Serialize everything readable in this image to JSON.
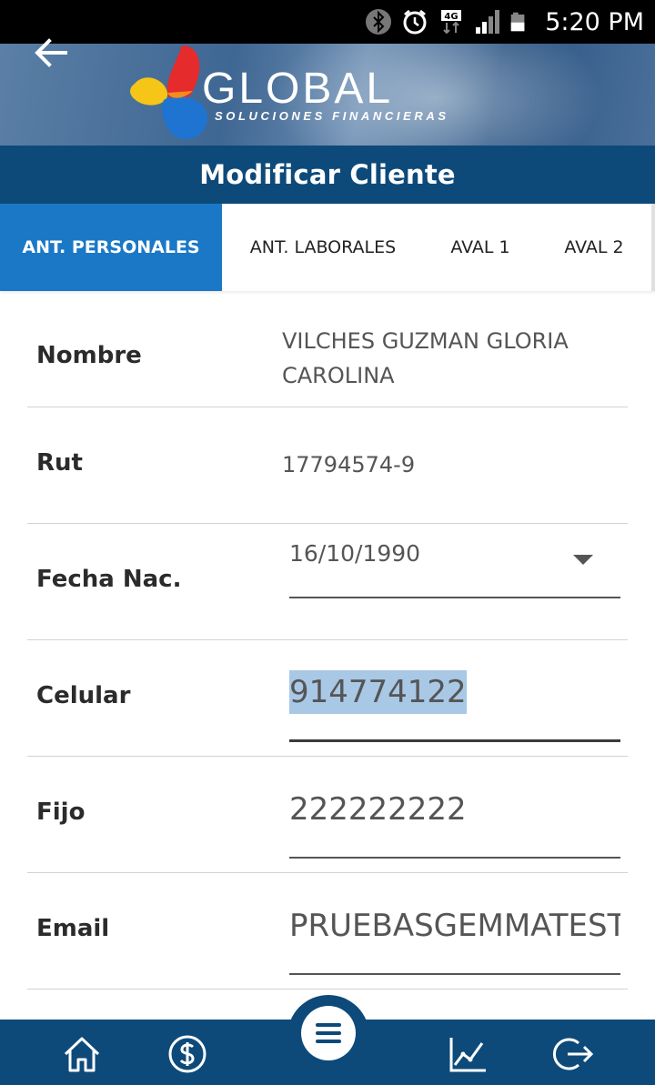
{
  "status_bar": {
    "time": "5:20 PM",
    "icons": [
      "bluetooth-icon",
      "alarm-icon",
      "4g-data-icon",
      "signal-icon",
      "battery-icon"
    ]
  },
  "header": {
    "back_icon": "arrow-left-icon",
    "logo_text": "GLOBAL",
    "logo_subtitle": "SOLUCIONES FINANCIERAS",
    "title": "Modificar Cliente"
  },
  "tabs": [
    {
      "label": "ANT. PERSONALES",
      "active": true
    },
    {
      "label": "ANT. LABORALES",
      "active": false
    },
    {
      "label": "AVAL 1",
      "active": false
    },
    {
      "label": "AVAL 2",
      "active": false
    }
  ],
  "form": {
    "nombre": {
      "label": "Nombre",
      "value": "VILCHES GUZMAN GLORIA CAROLINA"
    },
    "rut": {
      "label": "Rut",
      "value": "17794574-9"
    },
    "fecha_nac": {
      "label": "Fecha Nac.",
      "value": "16/10/1990"
    },
    "celular": {
      "label": "Celular",
      "value": "914774122"
    },
    "fijo": {
      "label": "Fijo",
      "value": "222222222"
    },
    "email": {
      "label": "Email",
      "value": "PRUEBASGEMMATEST@"
    }
  },
  "bottom_nav": {
    "items": [
      "home-icon",
      "dollar-icon",
      "menu-icon",
      "chart-icon",
      "logout-icon"
    ]
  },
  "colors": {
    "primary": "#0d4a7a",
    "tab_active": "#1a78c7",
    "selection": "#a8c8e6"
  }
}
